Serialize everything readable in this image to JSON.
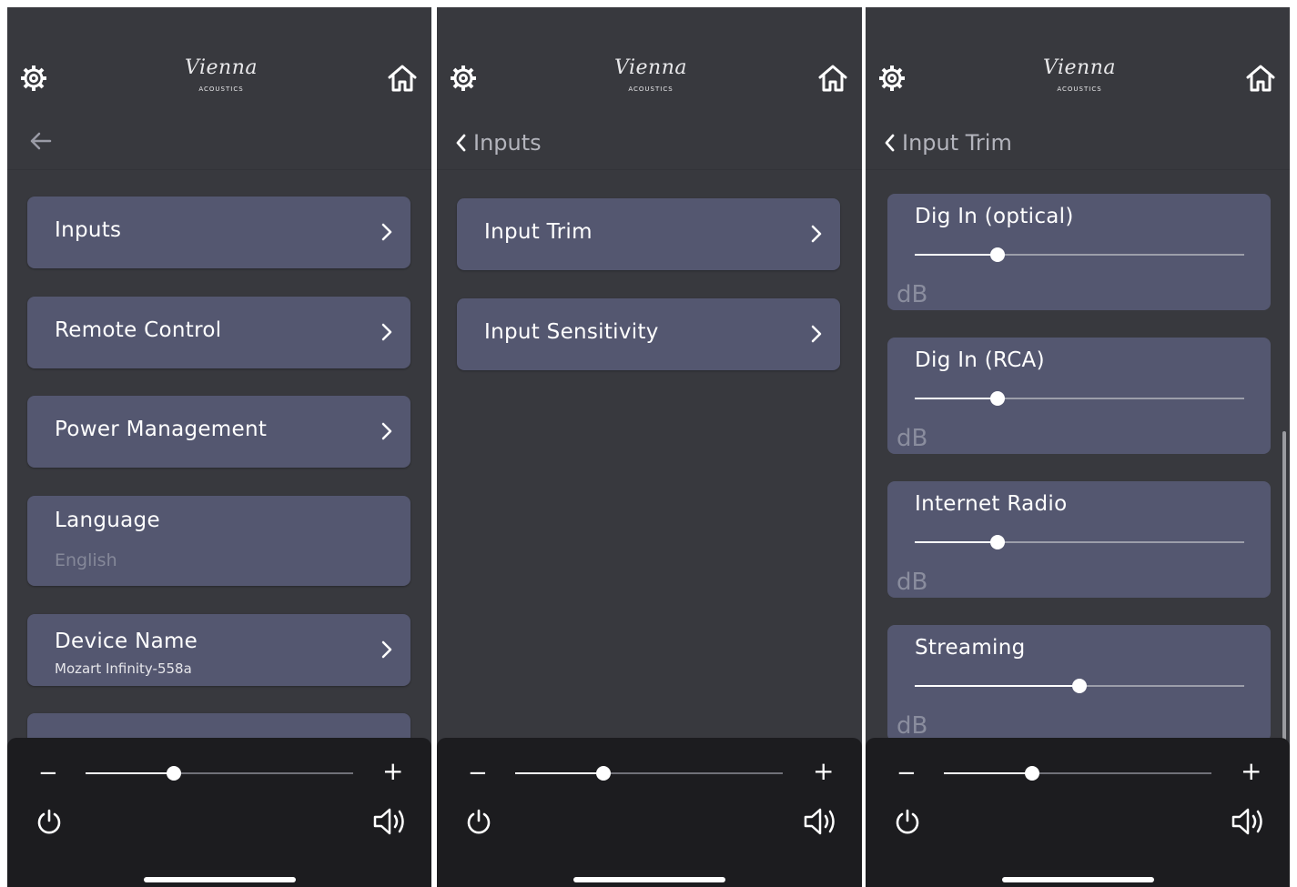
{
  "brand": {
    "logo_script": "Vienna",
    "logo_sub": "ACOUSTICS"
  },
  "panel1": {
    "items": [
      {
        "label": "Inputs"
      },
      {
        "label": "Remote Control"
      },
      {
        "label": "Power Management"
      },
      {
        "label": "Language",
        "sub": "English"
      },
      {
        "label": "Device Name",
        "sub": "Mozart Infinity-558a"
      }
    ]
  },
  "panel2": {
    "back_label": "Inputs",
    "items": [
      {
        "label": "Input Trim"
      },
      {
        "label": "Input Sensitivity"
      }
    ]
  },
  "panel3": {
    "back_label": "Input Trim",
    "trims": [
      {
        "label": "Dig In (optical)",
        "unit": "dB",
        "level": 0.25
      },
      {
        "label": "Dig In (RCA)",
        "unit": "dB",
        "level": 0.25
      },
      {
        "label": "Internet Radio",
        "unit": "dB",
        "level": 0.25
      },
      {
        "label": "Streaming",
        "unit": "dB",
        "level": 0.5
      }
    ]
  },
  "player": {
    "minus": "−",
    "plus": "+",
    "volume_levels": [
      0.33,
      0.33,
      0.33
    ]
  }
}
